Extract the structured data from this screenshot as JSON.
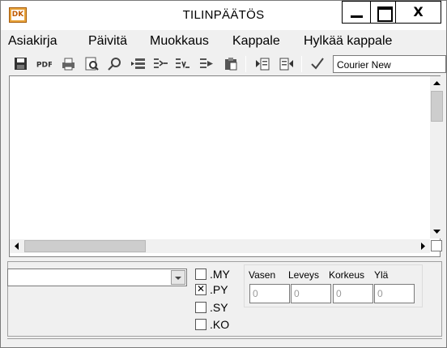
{
  "window": {
    "title": "TILINPÄÄTÖS",
    "icon_text": "DK",
    "close_glyph": "X"
  },
  "menu": [
    {
      "label": "Asiakirja"
    },
    {
      "label": "Päivitä"
    },
    {
      "label": "Muokkaus"
    },
    {
      "label": "Kappale"
    },
    {
      "label": "Hylkää kappale"
    }
  ],
  "toolbar": {
    "icons": [
      "save-icon",
      "pdf-icon",
      "print-icon",
      "print-preview-icon",
      "search-icon",
      "insert-row-icon",
      "indent-icon",
      "outdent-icon",
      "move-icon",
      "paste-icon",
      "next-page-icon",
      "prev-page-icon",
      "check-icon"
    ],
    "font": "Courier New"
  },
  "options": {
    "combo_value": "",
    "checkboxes": [
      {
        "label": ".MY",
        "checked": false
      },
      {
        "label": ".PY",
        "checked": true
      },
      {
        "label": ".SY",
        "checked": false
      },
      {
        "label": ".KO",
        "checked": false
      }
    ]
  },
  "dimensions": {
    "labels": [
      "Vasen",
      "Leveys",
      "Korkeus",
      "Ylä"
    ],
    "values": [
      "0",
      "0",
      "0",
      "0"
    ]
  }
}
